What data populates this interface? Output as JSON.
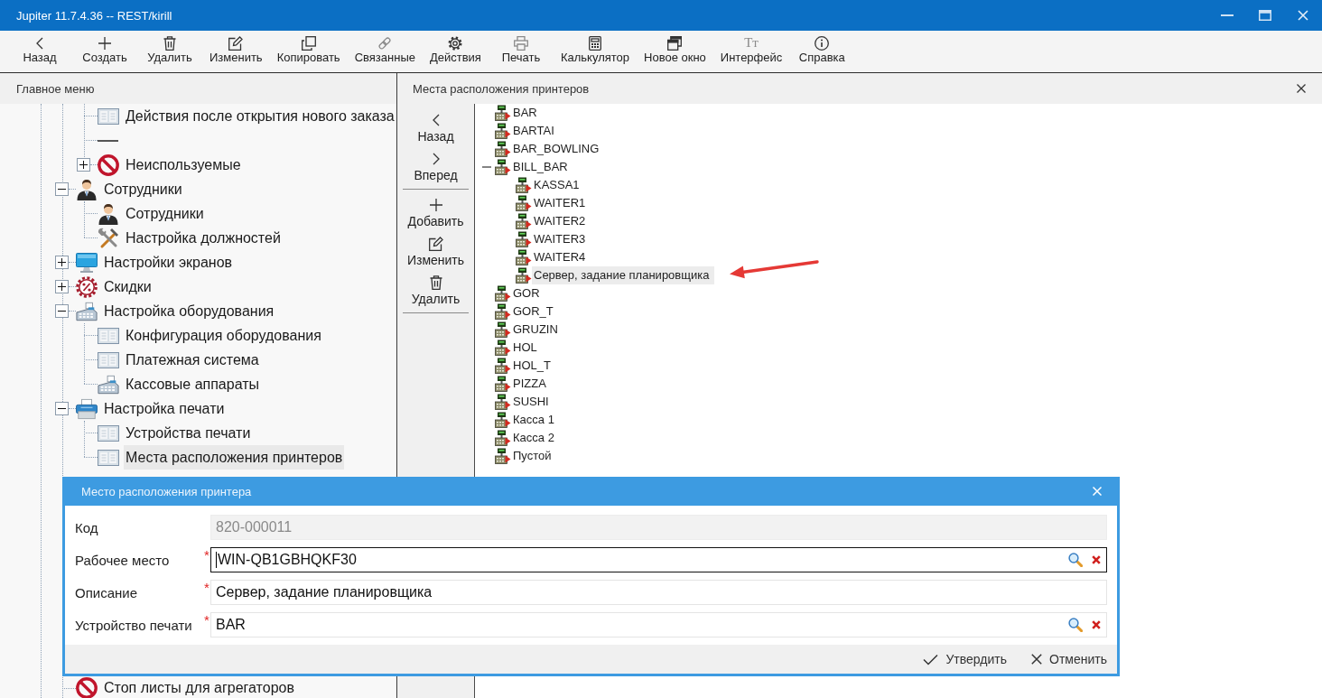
{
  "window": {
    "title": "Jupiter 11.7.4.36 -- REST/kirill"
  },
  "toolbar": [
    {
      "label": "Назад"
    },
    {
      "label": "Создать"
    },
    {
      "label": "Удалить"
    },
    {
      "label": "Изменить"
    },
    {
      "label": "Копировать"
    },
    {
      "label": "Связанные"
    },
    {
      "label": "Действия"
    },
    {
      "label": "Печать"
    },
    {
      "label": "Калькулятор"
    },
    {
      "label": "Новое окно"
    },
    {
      "label": "Интерфейс",
      "glyph": "Tт"
    },
    {
      "label": "Справка"
    }
  ],
  "main_menu": {
    "title": "Главное меню",
    "items": [
      {
        "children": [
          {
            "kind": "form",
            "label": "Действия после открытия нового заказа",
            "selected": false
          },
          {
            "kind": "separator"
          },
          {
            "kind": "blocked",
            "label": "Неиспользуемые",
            "expanded": false,
            "selected": false
          }
        ]
      },
      {
        "kind": "staff",
        "label": "Сотрудники",
        "expanded": true,
        "selected": false,
        "children": [
          {
            "kind": "staff",
            "label": "Сотрудники",
            "selected": false
          },
          {
            "kind": "tools",
            "label": "Настройка должностей",
            "selected": false
          }
        ]
      },
      {
        "kind": "monitor",
        "label": "Настройки экранов",
        "expanded": false,
        "selected": false
      },
      {
        "kind": "discount",
        "label": "Скидки",
        "expanded": false,
        "selected": false
      },
      {
        "kind": "register",
        "label": "Настройка оборудования",
        "expanded": true,
        "selected": false,
        "children": [
          {
            "kind": "form",
            "label": "Конфигурация оборудования",
            "selected": false
          },
          {
            "kind": "form",
            "label": "Платежная система",
            "selected": false
          },
          {
            "kind": "register",
            "label": "Кассовые аппараты",
            "selected": false
          }
        ]
      },
      {
        "kind": "printer",
        "label": "Настройка печати",
        "expanded": true,
        "selected": false,
        "children": [
          {
            "kind": "form",
            "label": "Устройства печати",
            "selected": false
          },
          {
            "kind": "form",
            "label": "Места расположения принтеров",
            "selected": true
          }
        ]
      },
      {
        "kind": "blocked",
        "label": "Стоп листы для агрегаторов",
        "selected": false
      }
    ]
  },
  "printer_locations": {
    "title": "Места расположения принтеров",
    "action_groups": [
      [
        {
          "label": "Назад"
        },
        {
          "label": "Вперед"
        }
      ],
      [
        {
          "label": "Добавить"
        },
        {
          "label": "Изменить"
        },
        {
          "label": "Удалить"
        }
      ]
    ],
    "items": [
      {
        "label": "BAR",
        "selected": false
      },
      {
        "label": "BARTAI",
        "selected": false
      },
      {
        "label": "BAR_BOWLING",
        "selected": false
      },
      {
        "label": "BILL_BAR",
        "selected": false,
        "expanded": true,
        "children": [
          {
            "label": "KASSA1",
            "selected": false
          },
          {
            "label": "WAITER1",
            "selected": false
          },
          {
            "label": "WAITER2",
            "selected": false
          },
          {
            "label": "WAITER3",
            "selected": false
          },
          {
            "label": "WAITER4",
            "selected": false
          },
          {
            "label": "Сервер, задание планировщика",
            "selected": true
          }
        ]
      },
      {
        "label": "GOR",
        "selected": false
      },
      {
        "label": "GOR_T",
        "selected": false
      },
      {
        "label": "GRUZIN",
        "selected": false
      },
      {
        "label": "HOL",
        "selected": false
      },
      {
        "label": "HOL_T",
        "selected": false
      },
      {
        "label": "PIZZA",
        "selected": false
      },
      {
        "label": "SUSHI",
        "selected": false
      },
      {
        "label": "Касса 1",
        "selected": false
      },
      {
        "label": "Касса 2",
        "selected": false
      },
      {
        "label": "Пустой",
        "selected": false
      }
    ]
  },
  "dialog": {
    "title": "Место расположения принтера",
    "fields": [
      {
        "kind": "text",
        "label": "Код",
        "value": "820-000011",
        "disabled": true,
        "focused": false
      },
      {
        "kind": "lookup",
        "label": "Рабочее место",
        "marker": "*",
        "value": "WIN-QB1GBHQKF30",
        "disabled": false,
        "focused": true
      },
      {
        "kind": "text",
        "label": "Описание",
        "marker": "*",
        "value": "Сервер, задание планировщика",
        "disabled": false,
        "focused": false
      },
      {
        "kind": "lookup",
        "label": "Устройство печати",
        "marker": "*",
        "value": "BAR",
        "disabled": false,
        "focused": false
      }
    ],
    "buttons": [
      {
        "kind": "confirm",
        "label": "Утвердить"
      },
      {
        "kind": "cancel",
        "label": "Отменить"
      }
    ]
  }
}
